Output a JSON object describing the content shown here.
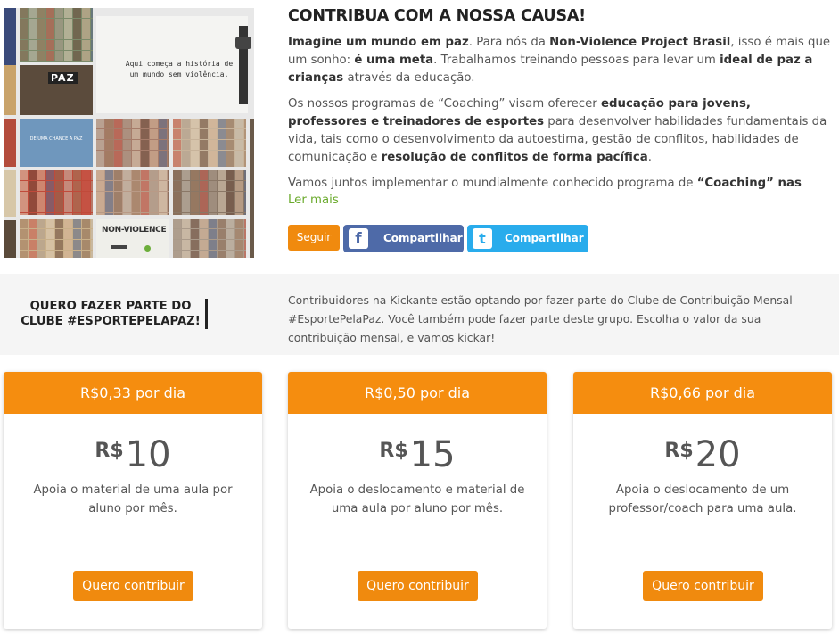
{
  "hero_image": {
    "slogan_line1": "Aqui começa a história de",
    "slogan_line2": "um mundo sem violência.",
    "paz_tag": "PAZ",
    "chance_text": "DÊ UMA CHANCE À PAZ",
    "nv_text": "NON-VIOLENCE"
  },
  "cause": {
    "title": "CONTRIBUA COM A NOSSA CAUSA!",
    "p1": [
      {
        "t": "Imagine um mundo em paz",
        "b": true
      },
      {
        "t": ". Para nós da ",
        "b": false
      },
      {
        "t": "Non-Violence Project Brasil",
        "b": true
      },
      {
        "t": ", isso é mais que um sonho: ",
        "b": false
      },
      {
        "t": "é uma meta",
        "b": true
      },
      {
        "t": ". Trabalhamos treinando pessoas para levar um ",
        "b": false
      },
      {
        "t": "ideal de paz a crianças",
        "b": true
      },
      {
        "t": " através da educação.",
        "b": false
      }
    ],
    "p2": [
      {
        "t": "Os nossos programas de “Coaching” visam oferecer ",
        "b": false
      },
      {
        "t": "educação para jovens, professores e treinadores de esportes",
        "b": true
      },
      {
        "t": " para desenvolver habilidades fundamentais da vida, tais como o desenvolvimento da autoestima, gestão de conflitos, habilidades de comunicação e ",
        "b": false
      },
      {
        "t": "resolução de conflitos de forma pacífica",
        "b": true
      },
      {
        "t": ".",
        "b": false
      }
    ],
    "p3": [
      {
        "t": "Vamos juntos implementar o mundialmente conhecido programa de ",
        "b": false
      },
      {
        "t": "“Coaching” nas",
        "b": true
      }
    ],
    "read_more": "Ler mais",
    "follow_label": "Seguir",
    "facebook_label": "Compartilhar",
    "twitter_label": "Compartilhar"
  },
  "club": {
    "title": "QUERO FAZER PARTE DO CLUBE #ESPORTEPELAPAZ!",
    "text": "Contribuidores na Kickante estão optando por fazer parte do Clube de Contribuição Mensal #EsportePelaPaz. Você também pode fazer parte deste grupo. Escolha o valor da sua contribuição mensal, e vamos kickar!"
  },
  "plans": [
    {
      "per_day": "R$0,33 por dia",
      "currency": "R$",
      "amount": "10",
      "description": "Apoia o material de uma aula por aluno por mês.",
      "cta": "Quero contribuir"
    },
    {
      "per_day": "R$0,50 por dia",
      "currency": "R$",
      "amount": "15",
      "description": "Apoia o deslocamento e material de uma aula por aluno por mês.",
      "cta": "Quero contribuir"
    },
    {
      "per_day": "R$0,66 por dia",
      "currency": "R$",
      "amount": "20",
      "description": "Apoia o deslocamento de um professor/coach para uma aula.",
      "cta": "Quero contribuir"
    }
  ],
  "colors": {
    "accent": "#f58d0f",
    "link": "#6aaa2c",
    "facebook": "#4e6aa8",
    "twitter": "#29acec"
  }
}
